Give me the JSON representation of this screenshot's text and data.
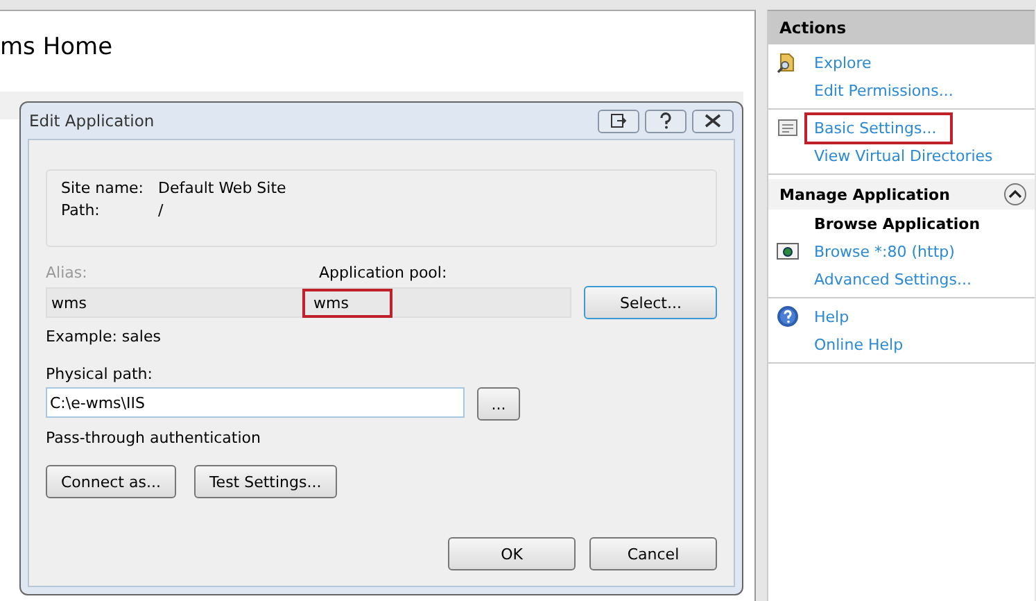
{
  "page": {
    "title": "ms Home"
  },
  "actions": {
    "title": "Actions",
    "sections": [
      {
        "items": [
          {
            "label": "Explore",
            "kind": "link",
            "highlighted": false
          },
          {
            "label": "Edit Permissions...",
            "kind": "link",
            "highlighted": false
          }
        ]
      },
      {
        "items": [
          {
            "label": "Basic Settings...",
            "kind": "link",
            "highlighted": true
          },
          {
            "label": "View Virtual Directories",
            "kind": "link",
            "highlighted": false
          }
        ]
      },
      {
        "title": "Manage Application",
        "expanded": true,
        "items": [
          {
            "label": "Browse Application",
            "kind": "heading",
            "highlighted": false
          },
          {
            "label": "Browse *:80 (http)",
            "kind": "link",
            "highlighted": false
          },
          {
            "label": "Advanced Settings...",
            "kind": "link",
            "highlighted": false
          }
        ]
      },
      {
        "items": [
          {
            "label": "Help",
            "kind": "link",
            "highlighted": false
          },
          {
            "label": "Online Help",
            "kind": "link",
            "highlighted": false
          }
        ]
      }
    ]
  },
  "dialog": {
    "title": "Edit Application",
    "info": [
      {
        "label": "Site name:",
        "value": "Default Web Site"
      },
      {
        "label": "Path:",
        "value": "/"
      }
    ],
    "alias": {
      "label": "Alias:",
      "value": "wms",
      "disabled": true
    },
    "app_pool": {
      "label": "Application pool:",
      "value": "wms",
      "highlighted": true
    },
    "select_button": "Select...",
    "example": "Example: sales",
    "physical_path": {
      "label": "Physical path:",
      "value": "C:\\e-wms\\IIS"
    },
    "browse_button": "...",
    "auth": "Pass-through authentication",
    "buttons": [
      "Connect as...",
      "Test Settings..."
    ],
    "footer_buttons": [
      "OK",
      "Cancel"
    ]
  }
}
